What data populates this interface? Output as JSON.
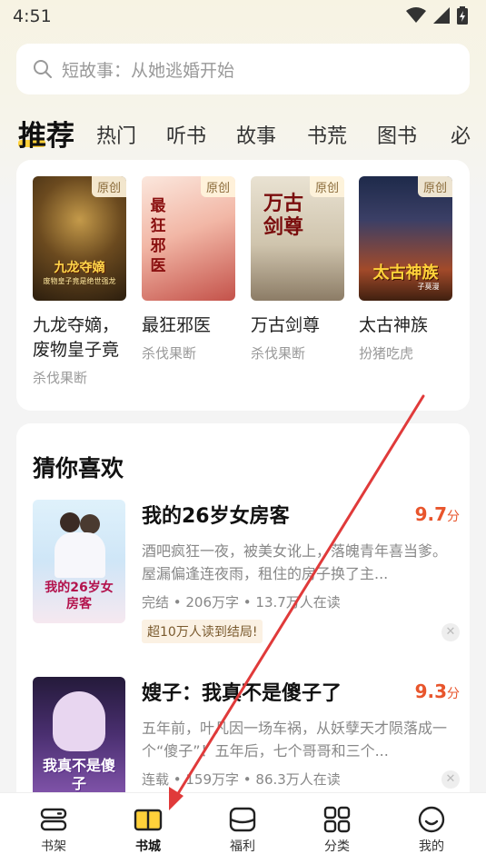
{
  "status": {
    "time": "4:51",
    "icons": [
      "wifi-icon",
      "signal-icon",
      "battery-icon"
    ]
  },
  "search": {
    "placeholder": "短故事：从她逃婚开始"
  },
  "tabs": [
    {
      "label": "推荐",
      "active": true
    },
    {
      "label": "热门"
    },
    {
      "label": "听书"
    },
    {
      "label": "故事"
    },
    {
      "label": "书荒"
    },
    {
      "label": "图书"
    },
    {
      "label": "必"
    }
  ],
  "recommend": {
    "tag": "原创",
    "books": [
      {
        "title": "九龙夺嫡，废物皇子竟",
        "author": "杀伐果断",
        "cover_text": "九龙夺嫡",
        "cover_subtext": "废物皇子竟是绝世强龙"
      },
      {
        "title": "最狂邪医",
        "author": "杀伐果断",
        "cover_text": "最狂邪医"
      },
      {
        "title": "万古剑尊",
        "author": "杀伐果断",
        "cover_text": "万古剑尊"
      },
      {
        "title": "太古神族",
        "author": "扮猪吃虎",
        "cover_text": "太古神族",
        "cover_subtext": "子莫漫"
      }
    ]
  },
  "guess": {
    "title": "猜你喜欢",
    "items": [
      {
        "title": "我的26岁女房客",
        "score": "9.7",
        "score_unit": "分",
        "desc": "酒吧疯狂一夜，被美女讹上，落魄青年喜当爹。屋漏偏逢连夜雨，租住的房子换了主...",
        "meta": "完结 • 206万字 • 13.7万人在读",
        "badge": "超10万人读到结局!",
        "cover_text": "我的26岁女房客",
        "close": "✕"
      },
      {
        "title": "嫂子：我真不是傻子了",
        "score": "9.3",
        "score_unit": "分",
        "desc": "五年前，叶凡因一场车祸，从妖孽天才陨落成一个“傻子”！五年后，七个哥哥和三个...",
        "meta": "连载 • 159万字 • 86.3万人在读",
        "cover_text": "我真不是傻子",
        "close": "✕"
      }
    ]
  },
  "nav": [
    {
      "label": "书架",
      "icon": "bookshelf-icon"
    },
    {
      "label": "书城",
      "icon": "bookstore-icon",
      "active": true
    },
    {
      "label": "福利",
      "icon": "welfare-icon"
    },
    {
      "label": "分类",
      "icon": "category-icon"
    },
    {
      "label": "我的",
      "icon": "profile-icon"
    }
  ],
  "colors": {
    "accent": "#ffd13a",
    "score": "#e8552c",
    "arrow": "#e03a3a"
  }
}
